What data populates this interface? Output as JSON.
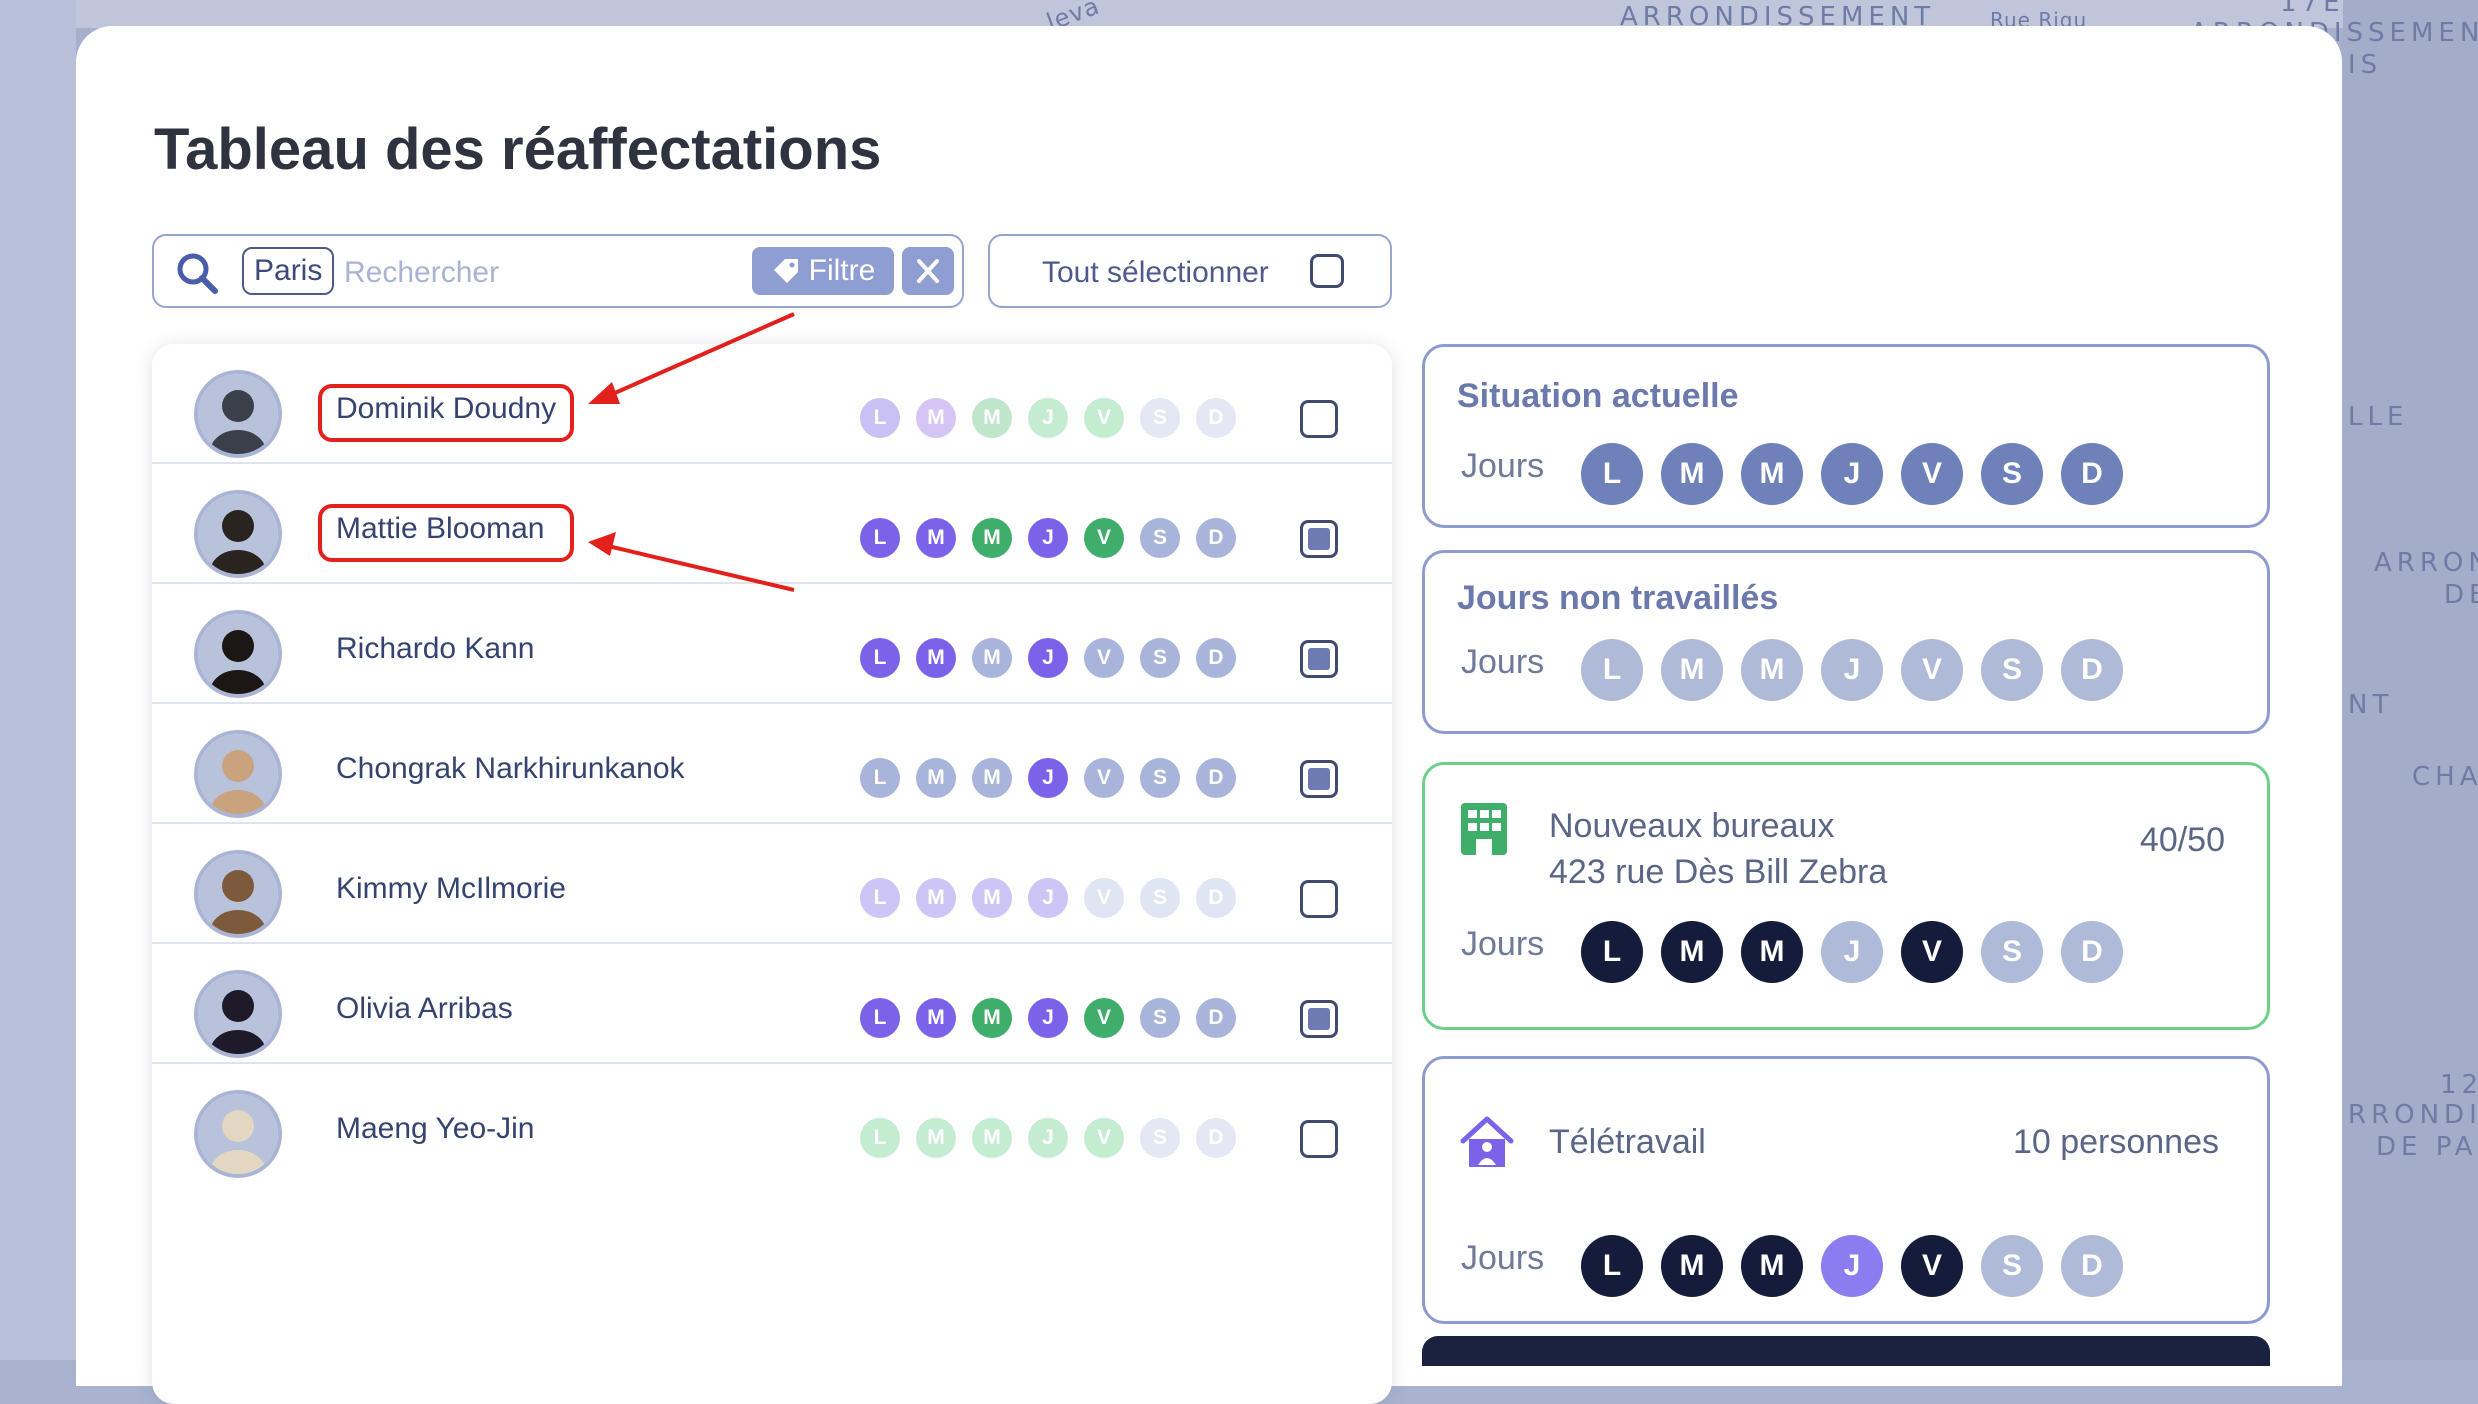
{
  "colors": {
    "accent": "#6b79ad",
    "highlight": "#e2201c",
    "office_border": "#6dcf8a"
  },
  "map": {
    "labels": [
      "ARRONDISSEMENT",
      "Rue Riqu",
      "ARRONDISSEMENT",
      "IS",
      "LLE",
      "ARRON",
      "DE",
      "NT",
      "CHA",
      "12",
      "RRONDIS",
      "DE PA",
      "leva",
      "17E"
    ]
  },
  "title": "Tableau des réaffectations",
  "search": {
    "chip": "Paris",
    "placeholder": "Rechercher",
    "filter_label": "Filtre",
    "search_icon": "search-icon",
    "tag_icon": "tag-icon",
    "clear_icon": "close-icon"
  },
  "select_all": {
    "label": "Tout sélectionner",
    "checked": false
  },
  "day_letters": [
    "L",
    "M",
    "M",
    "J",
    "V",
    "S",
    "D"
  ],
  "people": [
    {
      "name": "Dominik Doudny",
      "highlighted": true,
      "checked": false,
      "days": [
        "#c9c1f3",
        "#d5c5f5",
        "#bfe6cb",
        "#c4ecd1",
        "#c4ecd1",
        "#e3e8f4",
        "#e3e8f4"
      ]
    },
    {
      "name": "Mattie Blooman",
      "highlighted": true,
      "checked": true,
      "days": [
        "#7a63e8",
        "#7a63e8",
        "#3fae6b",
        "#7a63e8",
        "#3fae6b",
        "#a8b4d9",
        "#a8b4d9"
      ]
    },
    {
      "name": "Richardo Kann",
      "highlighted": false,
      "checked": true,
      "days": [
        "#7a63e8",
        "#7a63e8",
        "#a8b4d9",
        "#7a63e8",
        "#a8b4d9",
        "#a8b4d9",
        "#a8b4d9"
      ]
    },
    {
      "name": "Chongrak Narkhirunkanok",
      "highlighted": false,
      "checked": true,
      "days": [
        "#a8b4d9",
        "#a8b4d9",
        "#a8b4d9",
        "#7a63e8",
        "#a8b4d9",
        "#a8b4d9",
        "#a8b4d9"
      ]
    },
    {
      "name": "Kimmy McIlmorie",
      "highlighted": false,
      "checked": false,
      "days": [
        "#cdc5f5",
        "#cdc5f5",
        "#cdc5f5",
        "#cdc5f5",
        "#e0e5f3",
        "#e0e5f3",
        "#e0e5f3"
      ]
    },
    {
      "name": "Olivia Arribas",
      "highlighted": false,
      "checked": true,
      "days": [
        "#7a63e8",
        "#7a63e8",
        "#3fae6b",
        "#7a63e8",
        "#3fae6b",
        "#a8b4d9",
        "#a8b4d9"
      ]
    },
    {
      "name": "Maeng Yeo-Jin",
      "highlighted": false,
      "checked": false,
      "days": [
        "#c4ecd1",
        "#c4ecd1",
        "#c4ecd1",
        "#c4ecd1",
        "#c4ecd1",
        "#e3e8f4",
        "#e3e8f4"
      ]
    }
  ],
  "situation": {
    "title": "Situation actuelle",
    "jours_label": "Jours",
    "days": [
      "#6f81b9",
      "#6f81b9",
      "#6f81b9",
      "#6f81b9",
      "#6f81b9",
      "#6f81b9",
      "#6f81b9"
    ]
  },
  "non_worked": {
    "title": "Jours non travaillés",
    "jours_label": "Jours",
    "days": [
      "#aebad8",
      "#aebad8",
      "#aebad8",
      "#aebad8",
      "#aebad8",
      "#aebad8",
      "#aebad8"
    ]
  },
  "office": {
    "icon": "building-icon",
    "line1": "Nouveaux bureaux",
    "line2": "423 rue Dès Bill Zebra",
    "count": "40/50",
    "jours_label": "Jours",
    "days": [
      "#151c3b",
      "#151c3b",
      "#151c3b",
      "#aebad8",
      "#151c3b",
      "#aebad8",
      "#aebad8"
    ]
  },
  "remote": {
    "icon": "home-icon",
    "title": "Télétravail",
    "count": "10 personnes",
    "jours_label": "Jours",
    "days": [
      "#151c3b",
      "#151c3b",
      "#151c3b",
      "#8b7cf0",
      "#151c3b",
      "#aebad8",
      "#aebad8"
    ]
  }
}
